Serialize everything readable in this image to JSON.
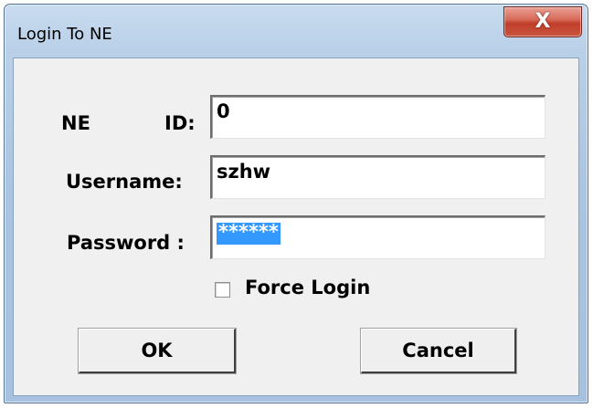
{
  "window": {
    "title": "Login To NE",
    "close_glyph": "X",
    "close_icon": "close-icon",
    "close_button_color": "#c9553f"
  },
  "form": {
    "ne_label": "NE",
    "id_label": "ID:",
    "ne_id_value": "0",
    "username_label": "Username:",
    "username_value": "szhw",
    "password_label": "Password :",
    "password_masked": "******",
    "password_selected": true,
    "selection_color": "#3399ff",
    "force_login_label": "Force Login",
    "force_login_checked": false
  },
  "buttons": {
    "ok_label": "OK",
    "cancel_label": "Cancel"
  }
}
